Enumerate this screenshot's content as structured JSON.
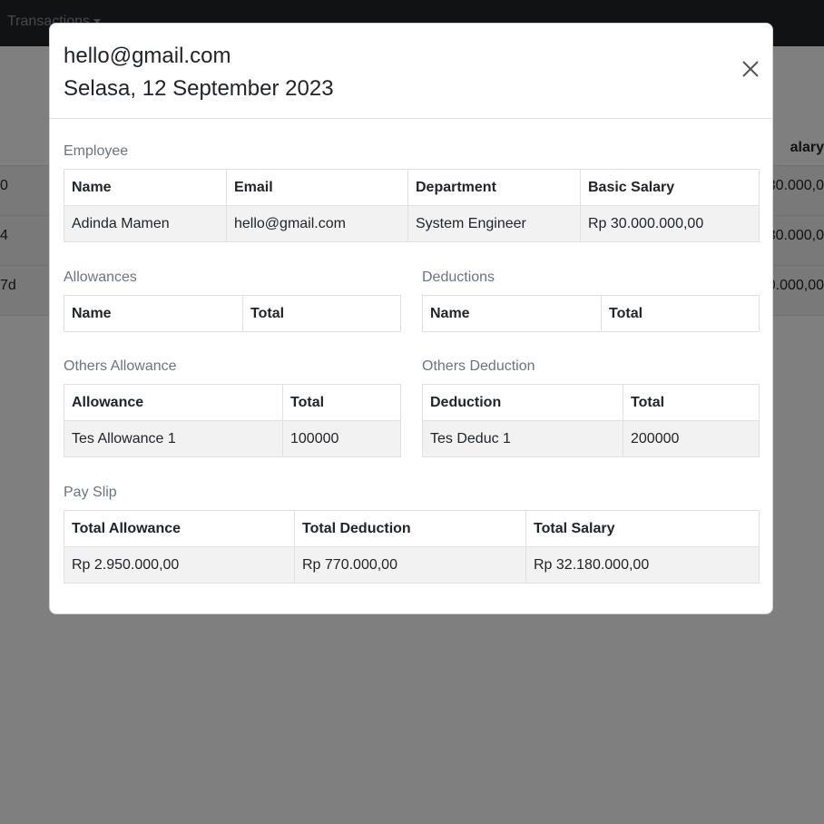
{
  "navbar": {
    "menu_transactions": "Transactions"
  },
  "background_table": {
    "header_right": "alary",
    "rows": [
      {
        "left": "0",
        "right": "30.000,0"
      },
      {
        "left": "4",
        "right": "30.000,0"
      },
      {
        "left": "7d",
        "right": "0.000,00"
      }
    ]
  },
  "modal": {
    "title_email": "hello@gmail.com",
    "title_date": "Selasa, 12 September 2023",
    "close_icon": "close-icon",
    "employee": {
      "label": "Employee",
      "headers": [
        "Name",
        "Email",
        "Department",
        "Basic Salary"
      ],
      "row": [
        "Adinda Mamen",
        "hello@gmail.com",
        "System Engineer",
        "Rp 30.000.000,00"
      ]
    },
    "allowances": {
      "label": "Allowances",
      "headers": [
        "Name",
        "Total"
      ]
    },
    "deductions": {
      "label": "Deductions",
      "headers": [
        "Name",
        "Total"
      ]
    },
    "others_allowance": {
      "label": "Others Allowance",
      "headers": [
        "Allowance",
        "Total"
      ],
      "row": [
        "Tes Allowance 1",
        "100000"
      ]
    },
    "others_deduction": {
      "label": "Others Deduction",
      "headers": [
        "Deduction",
        "Total"
      ],
      "row": [
        "Tes Deduc 1",
        "200000"
      ]
    },
    "pay_slip": {
      "label": "Pay Slip",
      "headers": [
        "Total Allowance",
        "Total Deduction",
        "Total Salary"
      ],
      "row": [
        "Rp 2.950.000,00",
        "Rp 770.000,00",
        "Rp 32.180.000,00"
      ]
    }
  }
}
